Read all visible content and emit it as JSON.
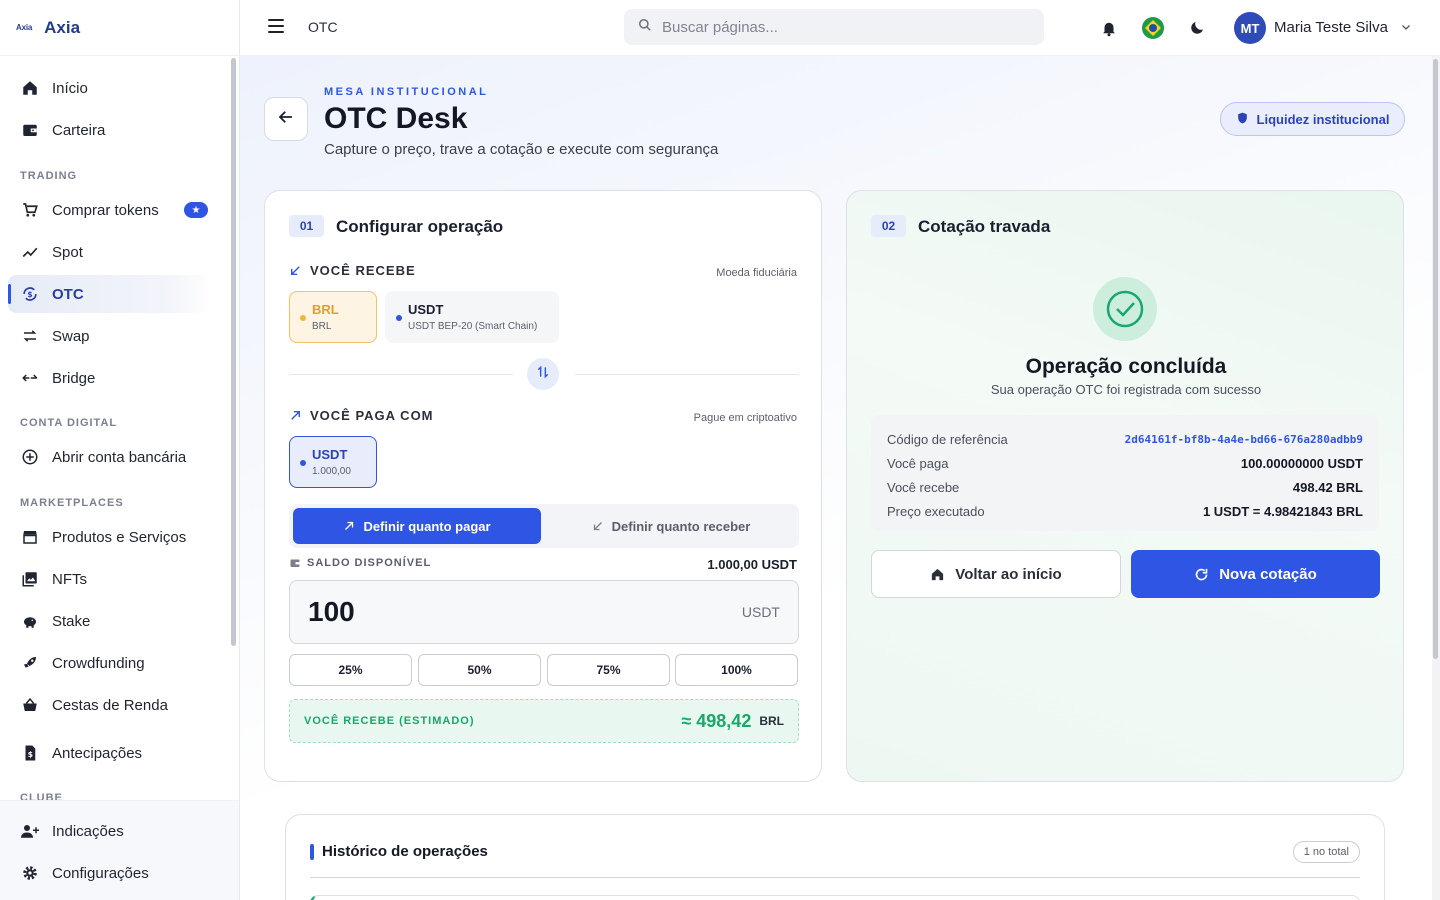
{
  "app": {
    "logo_mark": "Axia",
    "name": "Axia"
  },
  "sidebar": {
    "items": [
      {
        "label": "Início",
        "icon": "home-icon"
      },
      {
        "label": "Carteira",
        "icon": "wallet-icon"
      },
      {
        "label": "Comprar tokens",
        "icon": "cart-icon",
        "badge": "★"
      },
      {
        "label": "Spot",
        "icon": "chart-line-icon"
      },
      {
        "label": "OTC",
        "icon": "otc-icon",
        "active": true
      },
      {
        "label": "Swap",
        "icon": "swap-icon"
      },
      {
        "label": "Bridge",
        "icon": "bridge-icon"
      },
      {
        "label": "Abrir conta bancária",
        "icon": "plus-circle-icon"
      },
      {
        "label": "Produtos e Serviços",
        "icon": "store-icon"
      },
      {
        "label": "NFTs",
        "icon": "image-icon"
      },
      {
        "label": "Stake",
        "icon": "piggy-bank-icon"
      },
      {
        "label": "Crowdfunding",
        "icon": "rocket-icon"
      },
      {
        "label": "Cestas de Renda",
        "icon": "basket-icon"
      },
      {
        "label": "Antecipações",
        "icon": "invoice-icon"
      },
      {
        "label": "Indicações",
        "icon": "add-user-icon"
      },
      {
        "label": "Configurações",
        "icon": "gear-icon"
      }
    ],
    "sections": {
      "trading": "TRADING",
      "conta_digital": "CONTA DIGITAL",
      "marketplaces": "MARKETPLACES",
      "clube": "CLUBE"
    }
  },
  "topbar": {
    "breadcrumb": "OTC",
    "search_placeholder": "Buscar páginas...",
    "user_initials": "MT",
    "user_name": "Maria Teste Silva"
  },
  "header": {
    "eyebrow": "MESA INSTITUCIONAL",
    "title": "OTC Desk",
    "subtitle": "Capture o preço, trave a cotação e execute com segurança",
    "liquidity_pill": "Liquidez institucional"
  },
  "config": {
    "step": "01",
    "title": "Configurar operação",
    "receive_label": "VOCÊ RECEBE",
    "receive_hint": "Moeda fiduciária",
    "receive_options": [
      {
        "code": "BRL",
        "sub": "BRL",
        "selected": true
      },
      {
        "code": "USDT",
        "sub": "USDT BEP-20 (Smart Chain)",
        "selected": false
      }
    ],
    "pay_label": "VOCÊ PAGA COM",
    "pay_hint": "Pague em criptoativo",
    "pay_option": {
      "code": "USDT",
      "sub": "1.000,00"
    },
    "mode_pay": "Definir quanto pagar",
    "mode_receive": "Definir quanto receber",
    "balance_label": "SALDO DISPONÍVEL",
    "balance_value": "1.000,00 USDT",
    "amount": "100",
    "amount_unit": "USDT",
    "percent_buttons": [
      "25%",
      "50%",
      "75%",
      "100%"
    ],
    "estimate_label": "VOCÊ RECEBE (ESTIMADO)",
    "estimate_value": "≈ 498,42",
    "estimate_unit": "BRL"
  },
  "quote": {
    "step": "02",
    "title": "Cotação travada",
    "status_title": "Operação concluída",
    "status_sub": "Sua operação OTC foi registrada com sucesso",
    "rows": [
      {
        "key": "Código de referência",
        "value": "2d64161f-bf8b-4a4e-bd66-676a280adbb9"
      },
      {
        "key": "Você paga",
        "value": "100.00000000 USDT"
      },
      {
        "key": "Você recebe",
        "value": "498.42 BRL"
      },
      {
        "key": "Preço executado",
        "value": "1 USDT = 4.98421843 BRL"
      }
    ],
    "home_button": "Voltar ao início",
    "new_button": "Nova cotação"
  },
  "history": {
    "title": "Histórico de operações",
    "count": "1 no total"
  },
  "colors": {
    "accent": "#2f55e4",
    "success": "#19a86a",
    "brl": "#e0a12a"
  }
}
